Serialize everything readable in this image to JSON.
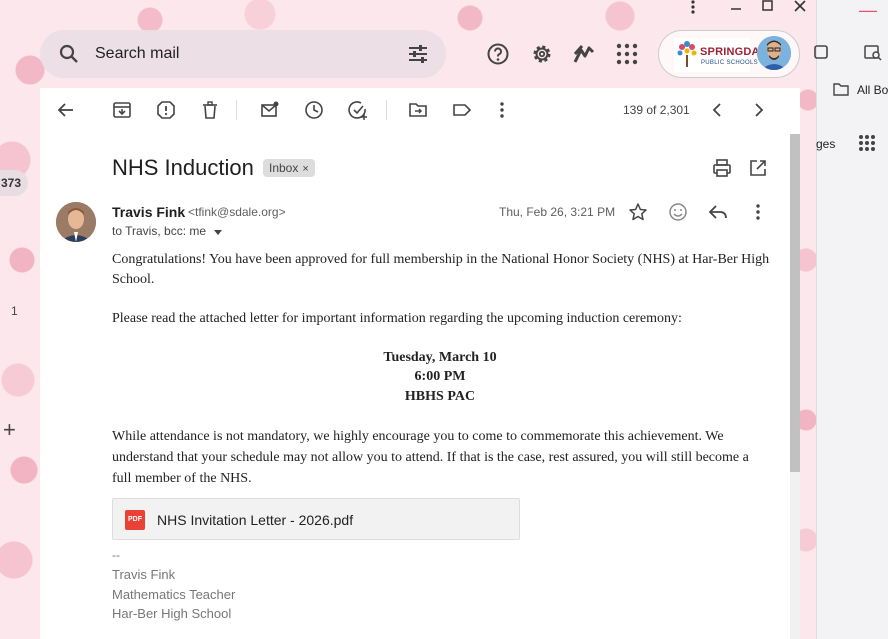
{
  "window": {
    "menu_icon": "vertical-dots-icon",
    "minimize": "—",
    "maximize": "☐",
    "close": "✕"
  },
  "search": {
    "placeholder": "Search mail"
  },
  "account": {
    "logo_line1": "SPRINGDALE",
    "logo_line2": "PUBLIC SCHOOLS"
  },
  "side_peek": {
    "count_badge": "373",
    "count_small": "1",
    "plus": "+"
  },
  "right_window": {
    "minimize": "—",
    "bookmarks_label": "All Bo",
    "pages_label": "ges"
  },
  "toolbar": {
    "pager_text": "139 of 2,301"
  },
  "email": {
    "subject": "NHS Induction",
    "label": "Inbox",
    "label_remove": "×",
    "sender_name": "Travis Fink",
    "sender_email": "<tfink@sdale.org>",
    "to_line": "to Travis, bcc: me",
    "date": "Thu, Feb 26, 3:21 PM",
    "para1": "Congratulations! You have been approved for full membership in the National Honor Society (NHS) at Har-Ber High School.",
    "para2": "Please read the attached letter for important information regarding the upcoming induction ceremony:",
    "event_date": "Tuesday, March 10",
    "event_time": "6:00 PM",
    "event_place": "HBHS PAC",
    "para3": "While attendance is not mandatory, we highly encourage you to come to commemorate this achievement. We understand that your schedule may not allow you to attend. If that is the case, rest assured, you will still become a full member of the NHS.",
    "attachment_type": "PDF",
    "attachment_name": "NHS Invitation Letter - 2026.pdf",
    "sig_dash": "--",
    "sig_name": "Travis Fink",
    "sig_title": "Mathematics Teacher",
    "sig_school": "Har-Ber High School"
  }
}
